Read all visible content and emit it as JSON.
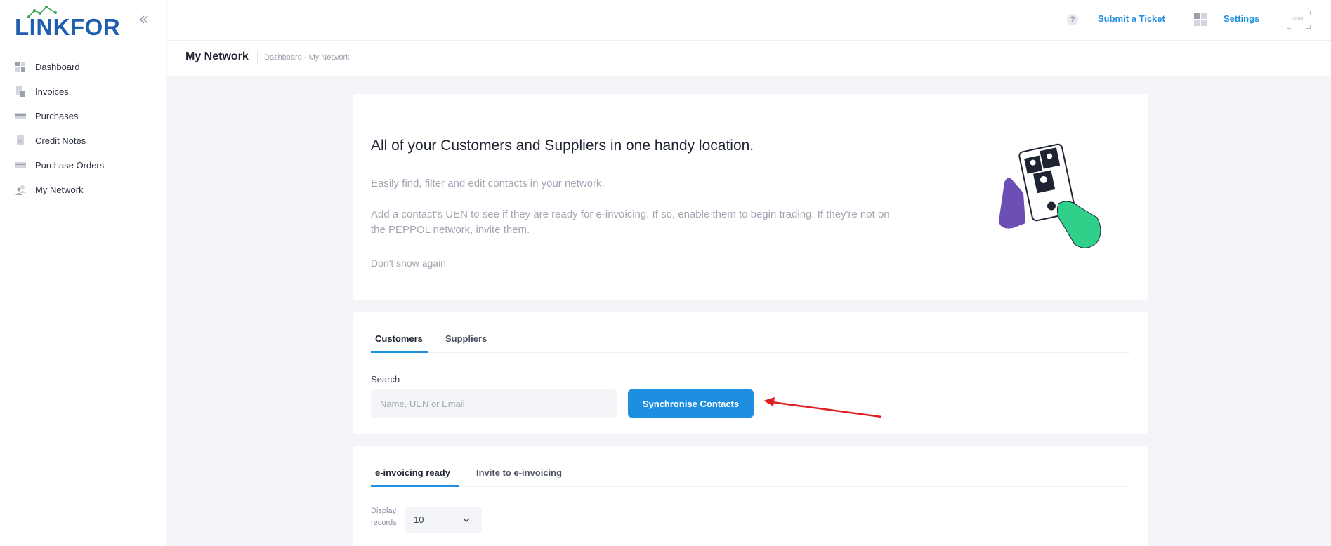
{
  "app": {
    "brand": "LINKFOR"
  },
  "sidebar": {
    "items": [
      {
        "label": "Dashboard",
        "icon": "dashboard-icon"
      },
      {
        "label": "Invoices",
        "icon": "invoice-icon"
      },
      {
        "label": "Purchases",
        "icon": "card-icon"
      },
      {
        "label": "Credit Notes",
        "icon": "document-icon"
      },
      {
        "label": "Purchase Orders",
        "icon": "card-icon"
      },
      {
        "label": "My Network",
        "icon": "people-icon"
      }
    ]
  },
  "topbar": {
    "help_symbol": "?",
    "submit_ticket": "Submit a Ticket",
    "settings": "Settings",
    "logo_placeholder": "LOGO"
  },
  "header": {
    "title": "My Network",
    "breadcrumb": "Dashboard - My Network"
  },
  "hero": {
    "title": "All of your Customers and Suppliers in one handy location.",
    "line1": "Easily find, filter and edit contacts in your network.",
    "line2": "Add a contact's UEN to see if they are ready for e-invoicing. If so, enable them to begin trading. If they're not on the PEPPOL network, invite them.",
    "dont_show": "Don't show again"
  },
  "contacts": {
    "tabs": [
      {
        "label": "Customers",
        "active": true
      },
      {
        "label": "Suppliers",
        "active": false
      }
    ],
    "search_label": "Search",
    "search_placeholder": "Name, UEN or Email",
    "sync_button": "Synchronise Contacts"
  },
  "list": {
    "tabs": [
      {
        "label": "e-invoicing ready",
        "active": true
      },
      {
        "label": "Invite to e-invoicing",
        "active": false
      }
    ],
    "display_label": "Display records",
    "display_value": "10"
  },
  "colors": {
    "accent": "#1e8fe0",
    "brand": "#1f5fae",
    "annotation_arrow": "#e02020"
  }
}
